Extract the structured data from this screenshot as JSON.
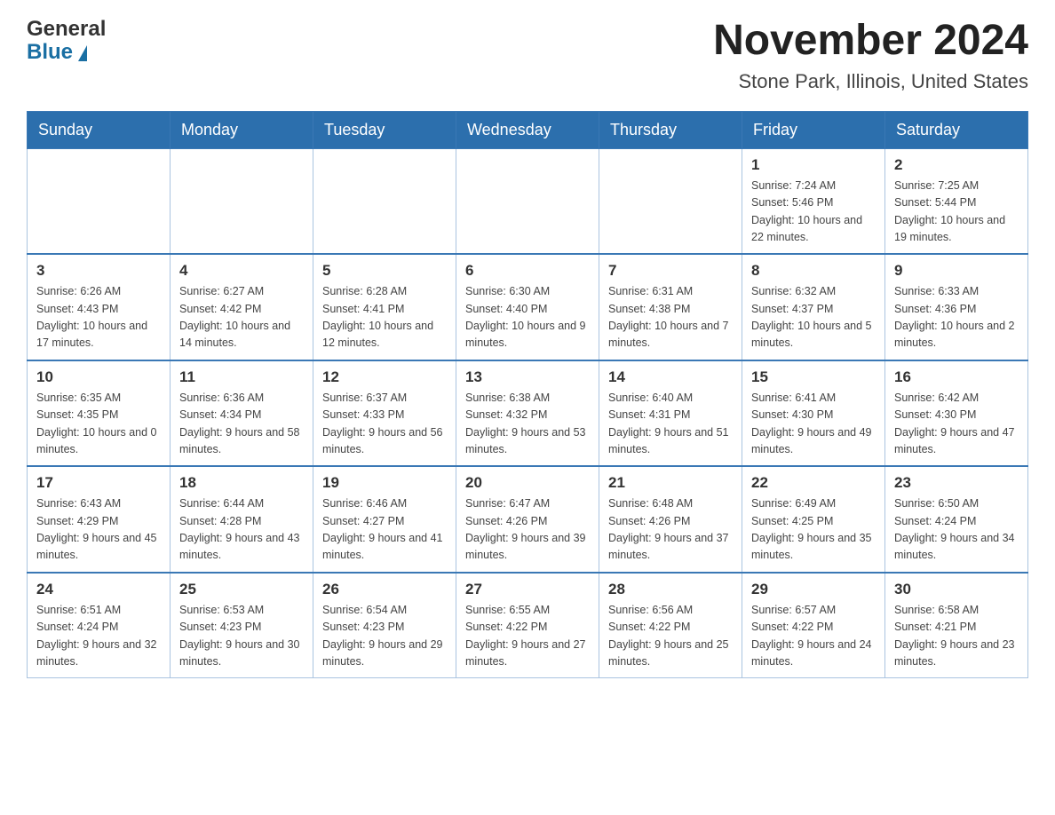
{
  "header": {
    "logo_text1": "General",
    "logo_text2": "Blue",
    "title": "November 2024",
    "subtitle": "Stone Park, Illinois, United States"
  },
  "weekdays": [
    "Sunday",
    "Monday",
    "Tuesday",
    "Wednesday",
    "Thursday",
    "Friday",
    "Saturday"
  ],
  "weeks": [
    [
      {
        "day": "",
        "info": ""
      },
      {
        "day": "",
        "info": ""
      },
      {
        "day": "",
        "info": ""
      },
      {
        "day": "",
        "info": ""
      },
      {
        "day": "",
        "info": ""
      },
      {
        "day": "1",
        "info": "Sunrise: 7:24 AM\nSunset: 5:46 PM\nDaylight: 10 hours and 22 minutes."
      },
      {
        "day": "2",
        "info": "Sunrise: 7:25 AM\nSunset: 5:44 PM\nDaylight: 10 hours and 19 minutes."
      }
    ],
    [
      {
        "day": "3",
        "info": "Sunrise: 6:26 AM\nSunset: 4:43 PM\nDaylight: 10 hours and 17 minutes."
      },
      {
        "day": "4",
        "info": "Sunrise: 6:27 AM\nSunset: 4:42 PM\nDaylight: 10 hours and 14 minutes."
      },
      {
        "day": "5",
        "info": "Sunrise: 6:28 AM\nSunset: 4:41 PM\nDaylight: 10 hours and 12 minutes."
      },
      {
        "day": "6",
        "info": "Sunrise: 6:30 AM\nSunset: 4:40 PM\nDaylight: 10 hours and 9 minutes."
      },
      {
        "day": "7",
        "info": "Sunrise: 6:31 AM\nSunset: 4:38 PM\nDaylight: 10 hours and 7 minutes."
      },
      {
        "day": "8",
        "info": "Sunrise: 6:32 AM\nSunset: 4:37 PM\nDaylight: 10 hours and 5 minutes."
      },
      {
        "day": "9",
        "info": "Sunrise: 6:33 AM\nSunset: 4:36 PM\nDaylight: 10 hours and 2 minutes."
      }
    ],
    [
      {
        "day": "10",
        "info": "Sunrise: 6:35 AM\nSunset: 4:35 PM\nDaylight: 10 hours and 0 minutes."
      },
      {
        "day": "11",
        "info": "Sunrise: 6:36 AM\nSunset: 4:34 PM\nDaylight: 9 hours and 58 minutes."
      },
      {
        "day": "12",
        "info": "Sunrise: 6:37 AM\nSunset: 4:33 PM\nDaylight: 9 hours and 56 minutes."
      },
      {
        "day": "13",
        "info": "Sunrise: 6:38 AM\nSunset: 4:32 PM\nDaylight: 9 hours and 53 minutes."
      },
      {
        "day": "14",
        "info": "Sunrise: 6:40 AM\nSunset: 4:31 PM\nDaylight: 9 hours and 51 minutes."
      },
      {
        "day": "15",
        "info": "Sunrise: 6:41 AM\nSunset: 4:30 PM\nDaylight: 9 hours and 49 minutes."
      },
      {
        "day": "16",
        "info": "Sunrise: 6:42 AM\nSunset: 4:30 PM\nDaylight: 9 hours and 47 minutes."
      }
    ],
    [
      {
        "day": "17",
        "info": "Sunrise: 6:43 AM\nSunset: 4:29 PM\nDaylight: 9 hours and 45 minutes."
      },
      {
        "day": "18",
        "info": "Sunrise: 6:44 AM\nSunset: 4:28 PM\nDaylight: 9 hours and 43 minutes."
      },
      {
        "day": "19",
        "info": "Sunrise: 6:46 AM\nSunset: 4:27 PM\nDaylight: 9 hours and 41 minutes."
      },
      {
        "day": "20",
        "info": "Sunrise: 6:47 AM\nSunset: 4:26 PM\nDaylight: 9 hours and 39 minutes."
      },
      {
        "day": "21",
        "info": "Sunrise: 6:48 AM\nSunset: 4:26 PM\nDaylight: 9 hours and 37 minutes."
      },
      {
        "day": "22",
        "info": "Sunrise: 6:49 AM\nSunset: 4:25 PM\nDaylight: 9 hours and 35 minutes."
      },
      {
        "day": "23",
        "info": "Sunrise: 6:50 AM\nSunset: 4:24 PM\nDaylight: 9 hours and 34 minutes."
      }
    ],
    [
      {
        "day": "24",
        "info": "Sunrise: 6:51 AM\nSunset: 4:24 PM\nDaylight: 9 hours and 32 minutes."
      },
      {
        "day": "25",
        "info": "Sunrise: 6:53 AM\nSunset: 4:23 PM\nDaylight: 9 hours and 30 minutes."
      },
      {
        "day": "26",
        "info": "Sunrise: 6:54 AM\nSunset: 4:23 PM\nDaylight: 9 hours and 29 minutes."
      },
      {
        "day": "27",
        "info": "Sunrise: 6:55 AM\nSunset: 4:22 PM\nDaylight: 9 hours and 27 minutes."
      },
      {
        "day": "28",
        "info": "Sunrise: 6:56 AM\nSunset: 4:22 PM\nDaylight: 9 hours and 25 minutes."
      },
      {
        "day": "29",
        "info": "Sunrise: 6:57 AM\nSunset: 4:22 PM\nDaylight: 9 hours and 24 minutes."
      },
      {
        "day": "30",
        "info": "Sunrise: 6:58 AM\nSunset: 4:21 PM\nDaylight: 9 hours and 23 minutes."
      }
    ]
  ]
}
